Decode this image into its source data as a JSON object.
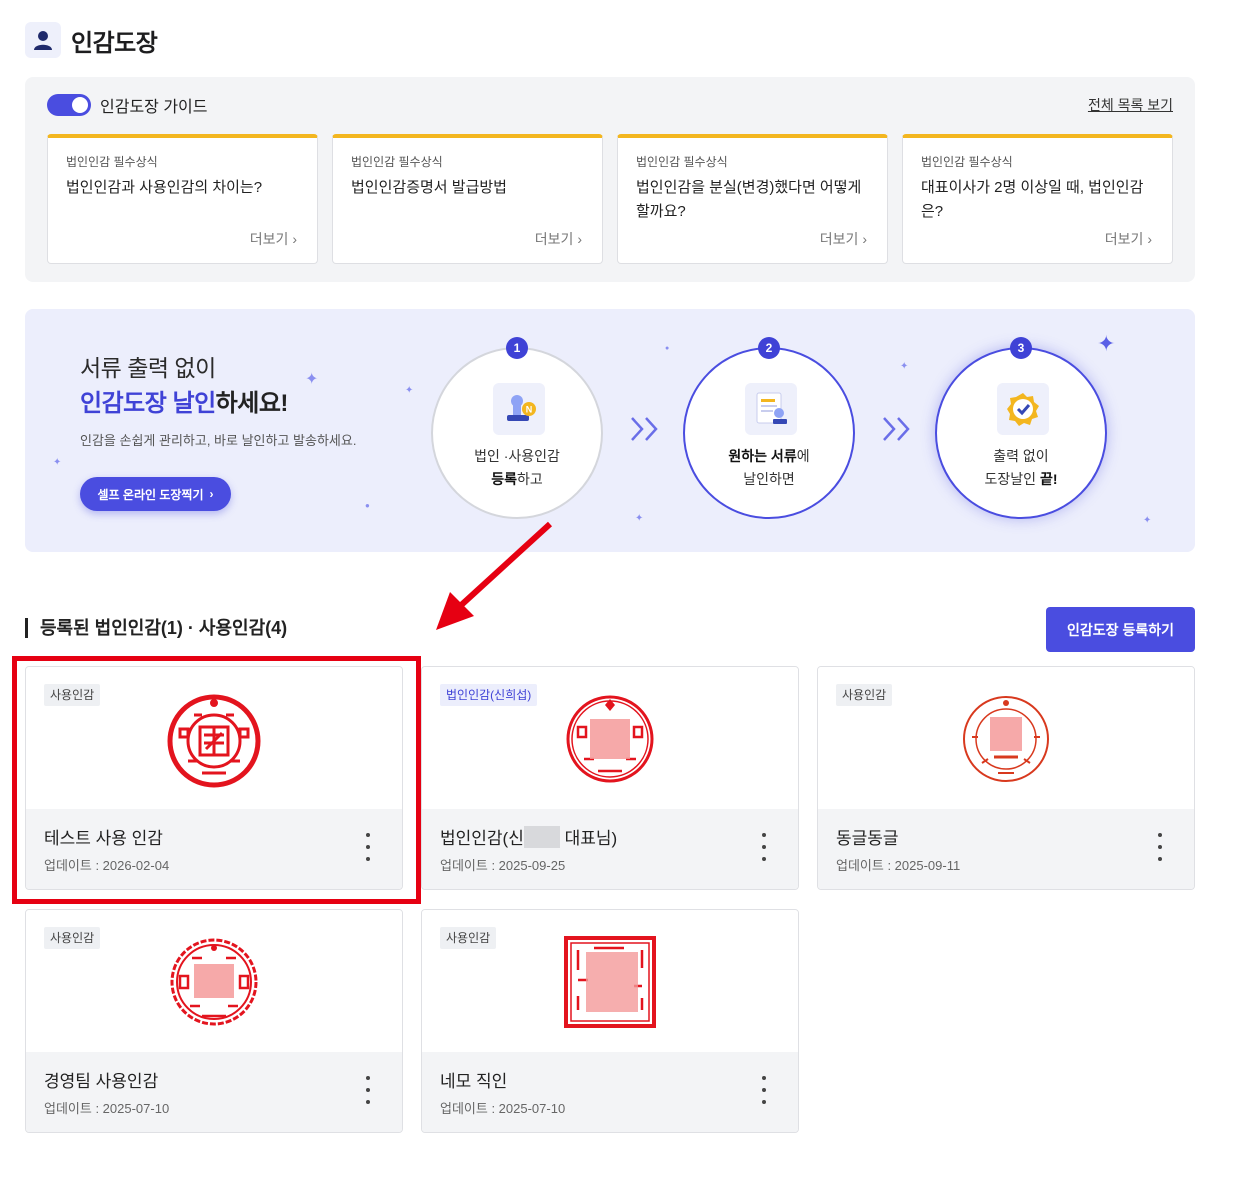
{
  "header": {
    "title": "인감도장",
    "icon": "person-icon"
  },
  "guide": {
    "toggle_label": "인감도장 가이드",
    "toggle_on": true,
    "view_all": "전체 목록 보기",
    "cards": [
      {
        "category": "법인인감 필수상식",
        "title": "법인인감과 사용인감의 차이는?",
        "more": "더보기"
      },
      {
        "category": "법인인감 필수상식",
        "title": "법인인감증명서 발급방법",
        "more": "더보기"
      },
      {
        "category": "법인인감 필수상식",
        "title": "법인인감을 분실(변경)했다면 어떻게 할까요?",
        "more": "더보기"
      },
      {
        "category": "법인인감 필수상식",
        "title": "대표이사가 2명 이상일 때, 법인인감은?",
        "more": "더보기"
      }
    ]
  },
  "banner": {
    "line1": "서류 출력 없이",
    "line2_highlight": "인감도장 날인",
    "line2_rest": "하세요!",
    "description": "인감을 손쉽게 관리하고, 바로 날인하고 발송하세요.",
    "button": "셀프 온라인 도장찍기",
    "steps": [
      {
        "num": "1",
        "line1": "법인 ·사용인감",
        "line2_bold": "등록",
        "line2_rest": "하고"
      },
      {
        "num": "2",
        "line1_bold": "원하는 서류",
        "line1_rest": "에",
        "line2": "날인하면"
      },
      {
        "num": "3",
        "line1": "출력 없이",
        "line2_rest": "도장날인 ",
        "line2_bold": "끝!"
      }
    ]
  },
  "section": {
    "title": "등록된 법인인감(1) · 사용인감(4)",
    "register_button": "인감도장 등록하기"
  },
  "seals": [
    {
      "tag": "사용인감",
      "name": "테스트 사용 인감",
      "date": "업데이트 : 2026-02-04"
    },
    {
      "tag": "법인인감(신희섭)",
      "name_prefix": "법인인감(신",
      "name_suffix": " 대표님)",
      "date": "업데이트 : 2025-09-25"
    },
    {
      "tag": "사용인감",
      "name": "동글동글",
      "date": "업데이트 : 2025-09-11"
    },
    {
      "tag": "사용인감",
      "name": "경영팀 사용인감",
      "date": "업데이트 : 2025-07-10"
    },
    {
      "tag": "사용인감",
      "name": "네모 직인",
      "date": "업데이트 : 2025-07-10"
    }
  ],
  "colors": {
    "accent": "#4a4de0",
    "guide_bar": "#f3b61f",
    "stamp_red": "#e3141e",
    "highlight": "#e60012"
  }
}
